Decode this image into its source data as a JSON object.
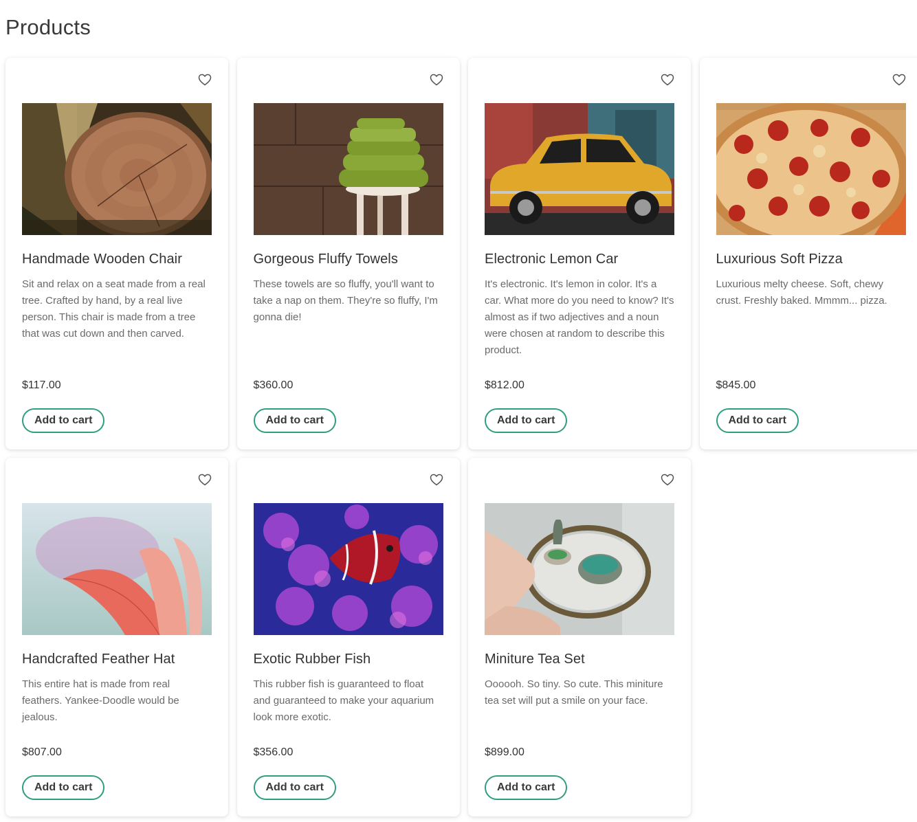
{
  "page": {
    "title": "Products"
  },
  "products": [
    {
      "name": "Handmade Wooden Chair",
      "description": "Sit and relax on a seat made from a real tree. Crafted by hand, by a real live person. This chair is made from a tree that was cut down and then carved.",
      "price": "$117.00",
      "cta": "Add to cart",
      "image": "wood-log-image"
    },
    {
      "name": "Gorgeous Fluffy Towels",
      "description": "These towels are so fluffy, you'll want to take a nap on them. They're so fluffy, I'm gonna die!",
      "price": "$360.00",
      "cta": "Add to cart",
      "image": "green-towels-image"
    },
    {
      "name": "Electronic Lemon Car",
      "description": "It's electronic. It's lemon in color. It's a car. What more do you need to know? It's almost as if two adjectives and a noun were chosen at random to describe this product.",
      "price": "$812.00",
      "cta": "Add to cart",
      "image": "yellow-car-image"
    },
    {
      "name": "Luxurious Soft Pizza",
      "description": "Luxurious melty cheese. Soft, chewy crust. Freshly baked. Mmmm... pizza.",
      "price": "$845.00",
      "cta": "Add to cart",
      "image": "pepperoni-pizza-image"
    },
    {
      "name": "Handcrafted Feather Hat",
      "description": "This entire hat is made from real feathers. Yankee-Doodle would be jealous.",
      "price": "$807.00",
      "cta": "Add to cart",
      "image": "pink-feather-image"
    },
    {
      "name": "Exotic Rubber Fish",
      "description": "This rubber fish is guaranteed to float and guaranteed to make your aquarium look more exotic.",
      "price": "$356.00",
      "cta": "Add to cart",
      "image": "clownfish-image"
    },
    {
      "name": "Miniture Tea Set",
      "description": "Oooooh. So tiny. So cute. This miniture tea set will put a smile on your face.",
      "price": "$899.00",
      "cta": "Add to cart",
      "image": "tiny-tea-set-image"
    }
  ],
  "icons": {
    "favorite": "heart-outline-icon"
  },
  "colors": {
    "accent": "#2e9e80",
    "text": "#333333",
    "muted": "#6a6a6a"
  }
}
